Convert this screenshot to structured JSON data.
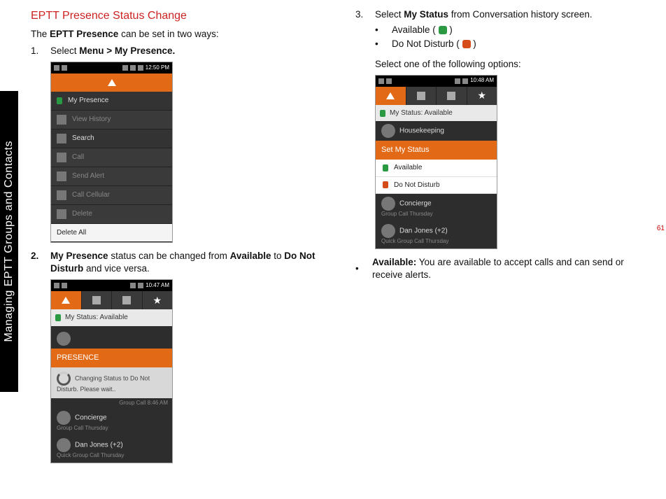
{
  "sidebar_label": "Managing EPTT Groups and Contacts",
  "page_number": "61",
  "left": {
    "heading": "EPTT Presence Status Change",
    "intro_pre": "The ",
    "intro_bold": "EPTT Presence",
    "intro_post": " can be set in two ways:",
    "step1_num": "1.",
    "step1_pre": "Select ",
    "step1_bold": "Menu > My Presence.",
    "step2_num": "2.",
    "step2_b1": "My Presence",
    "step2_mid1": " status can be changed from ",
    "step2_b2": "Available",
    "step2_mid2": " to ",
    "step2_b3": "Do Not Disturb",
    "step2_post": " and vice versa.",
    "phone1": {
      "time": "12:50 PM",
      "rows": [
        "My Presence",
        "View History",
        "Search",
        "Call",
        "Send Alert",
        "Call Cellular",
        "Delete",
        "Delete All"
      ]
    },
    "phone2": {
      "time": "10:47 AM",
      "status_label": "My Status: Available",
      "popup_title": "PRESENCE",
      "popup_text": "Changing Status to Do Not Disturb. Please wait..",
      "faded_line": "Group Call 8:46 AM",
      "row1_title": "Concierge",
      "row1_sub": "Group Call Thursday",
      "row2_title": "Dan Jones (+2)",
      "row2_sub": "Quick Group Call Thursday"
    }
  },
  "right": {
    "step3_num": "3.",
    "step3_pre": "Select ",
    "step3_bold": "My Status",
    "step3_post": " from Conversation history screen.",
    "opt_avail_pre": "Available ( ",
    "opt_avail_post": " )",
    "opt_dnd_pre": "Do Not Disturb ( ",
    "opt_dnd_post": " )",
    "select_text": "Select one of the following options:",
    "phone3": {
      "time": "10:48 AM",
      "status_label": "My Status: Available",
      "house": "Housekeeping",
      "popup_title": "Set My Status",
      "opt1": "Available",
      "opt2": "Do Not Disturb",
      "row1_title": "Concierge",
      "row1_sub": "Group Call Thursday",
      "row2_title": "Dan Jones (+2)",
      "row2_sub": "Quick Group Call Thursday"
    },
    "avail_bold": "Available:",
    "avail_text": " You are available to accept calls and can send or receive alerts."
  }
}
